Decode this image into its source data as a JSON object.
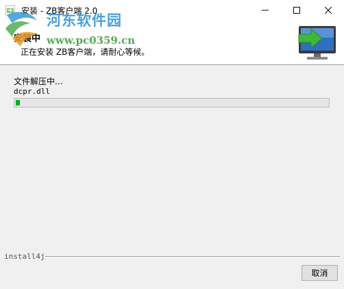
{
  "window": {
    "title": "安装 - ZB客户端 2.0",
    "controls": {
      "minimize": "minimize",
      "maximize": "maximize",
      "close": "close"
    }
  },
  "header": {
    "title": "安装中",
    "subtitle": "正在安装 ZB客户端，请耐心等候。",
    "icon": "monitor-arrow-icon"
  },
  "watermark": {
    "site_name": "河东软件园",
    "url": "www.pc0359.cn"
  },
  "main": {
    "status": "文件解压中...",
    "current_file": "dcpr.dll",
    "progress": 0.01
  },
  "footer": {
    "brand": "install4j",
    "cancel_label": "取消"
  },
  "colors": {
    "progress_fill": "#06b025",
    "monitor_arrow": "#3cb93c",
    "monitor_screen": "#2f6fbf"
  }
}
